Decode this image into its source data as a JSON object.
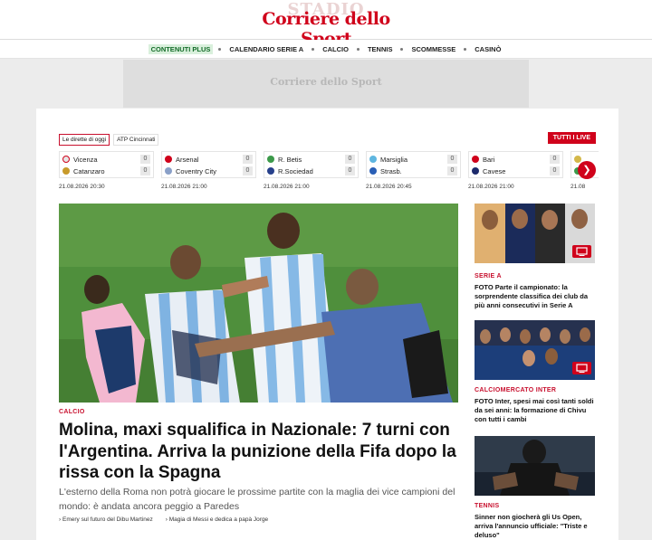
{
  "header": {
    "logo_text": "Corriere dello Sport",
    "logo_ghost_text": "STADIO"
  },
  "nav": [
    {
      "label": "CONTENUTI PLUS"
    },
    {
      "label": "CALENDARIO SERIE A"
    },
    {
      "label": "CALCIO"
    },
    {
      "label": "TENNIS"
    },
    {
      "label": "SCOMMESSE"
    },
    {
      "label": "CASINÒ"
    }
  ],
  "ad": {
    "logo_text": "Corriere dello Sport"
  },
  "live": {
    "tabs": [
      {
        "label": "Le dirette di oggi"
      },
      {
        "label": "ATP Cincinnati"
      }
    ],
    "all_button": "TUTTI I LIVE",
    "matches": [
      {
        "home": "Vicenza",
        "away": "Catanzaro",
        "home_score": "0",
        "away_score": "0",
        "date": "21.08.2026 20:30",
        "home_color": "#e6e6e6",
        "away_color": "#c89a2a"
      },
      {
        "home": "Arsenal",
        "away": "Coventry City",
        "home_score": "0",
        "away_score": "0",
        "date": "21.08.2026 21:00",
        "home_color": "#d0021b",
        "away_color": "#8aa0c8"
      },
      {
        "home": "R. Betis",
        "away": "R.Sociedad",
        "home_score": "0",
        "away_score": "0",
        "date": "21.08.2026 21:00",
        "home_color": "#3c9a4a",
        "away_color": "#27408b"
      },
      {
        "home": "Marsiglia",
        "away": "Strasb.",
        "home_score": "0",
        "away_score": "0",
        "date": "21.08.2026 20:45",
        "home_color": "#5fb6e0",
        "away_color": "#2a5fb6"
      },
      {
        "home": "Bari",
        "away": "Cavese",
        "home_score": "0",
        "away_score": "0",
        "date": "21.08.2026 21:00",
        "home_color": "#d0021b",
        "away_color": "#1c2a6b"
      },
      {
        "home": "",
        "away": "",
        "home_score": "",
        "away_score": "",
        "date": "21.08",
        "home_color": "#d4b84a",
        "away_color": "#3c9a4a"
      }
    ]
  },
  "hero": {
    "section": "CALCIO",
    "title": "Molina, maxi squalifica in Nazionale: 7 turni con l'Argentina. Arriva la punizione della Fifa dopo la rissa con la Spagna",
    "summary": "L'esterno della Roma non potrà giocare le prossime partite con la maglia dei vice campioni del mondo: è andata ancora peggio a Paredes",
    "related": [
      "Emery sul futuro del Dibu Martinez",
      "Magia di Messi e dedica a papà Jorge"
    ]
  },
  "sidebar": [
    {
      "section": "SERIE A",
      "title": "FOTO Parte il campionato: la sorprendente classifica dei club da più anni consecutivi in Serie A",
      "has_video": true
    },
    {
      "section": "CALCIOMERCATO INTER",
      "title": "FOTO Inter, spesi mai così tanti soldi da sei anni: la formazione di Chivu con tutti i cambi",
      "has_video": true
    },
    {
      "section": "TENNIS",
      "title": "Sinner non giocherà gli Us Open, arriva l'annuncio ufficiale: \"Triste e deluso\"",
      "has_video": false
    }
  ],
  "colors": {
    "brand_red": "#d0021b",
    "plus_green_bg": "#d9f0dc",
    "page_bg": "#ececec"
  }
}
